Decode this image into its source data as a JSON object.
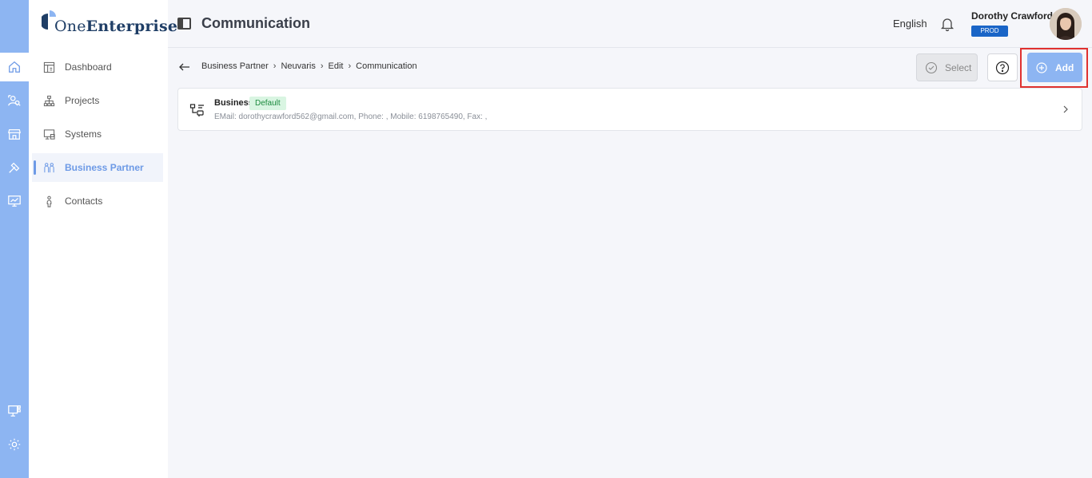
{
  "app": {
    "logo_text_light": "One",
    "logo_text_bold": "Enterprise"
  },
  "rail": {
    "items": [
      {
        "icon": "home-icon"
      },
      {
        "icon": "user-search-icon"
      },
      {
        "icon": "store-icon"
      },
      {
        "icon": "tools-icon"
      },
      {
        "icon": "monitor-chart-icon"
      }
    ],
    "bottom": [
      {
        "icon": "monitor-grid-icon"
      },
      {
        "icon": "gear-icon"
      }
    ]
  },
  "sidebar": {
    "items": [
      {
        "label": "Dashboard",
        "icon": "dashboard-icon"
      },
      {
        "label": "Projects",
        "icon": "hierarchy-icon"
      },
      {
        "label": "Systems",
        "icon": "systems-icon"
      },
      {
        "label": "Business Partner",
        "icon": "people-icon"
      },
      {
        "label": "Contacts",
        "icon": "person-icon"
      }
    ]
  },
  "header": {
    "title": "Communication",
    "language": "English",
    "user_name": "Dorothy Crawford",
    "env_badge": "PROD"
  },
  "breadcrumb": [
    "Business Partner",
    "Neuvaris",
    "Edit",
    "Communication"
  ],
  "toolbar": {
    "select_label": "Select",
    "add_label": "Add"
  },
  "communication_items": [
    {
      "title": "Business",
      "badge": "Default",
      "details": "EMail: dorothycrawford562@gmail.com, Phone: , Mobile: 6198765490, Fax: ,"
    }
  ],
  "colors": {
    "rail_bg": "#8db5f2",
    "accent": "#6d9ae6",
    "badge_env": "#1a65c7",
    "badge_default_bg": "#d9f5e2",
    "highlight": "#e0312f"
  }
}
